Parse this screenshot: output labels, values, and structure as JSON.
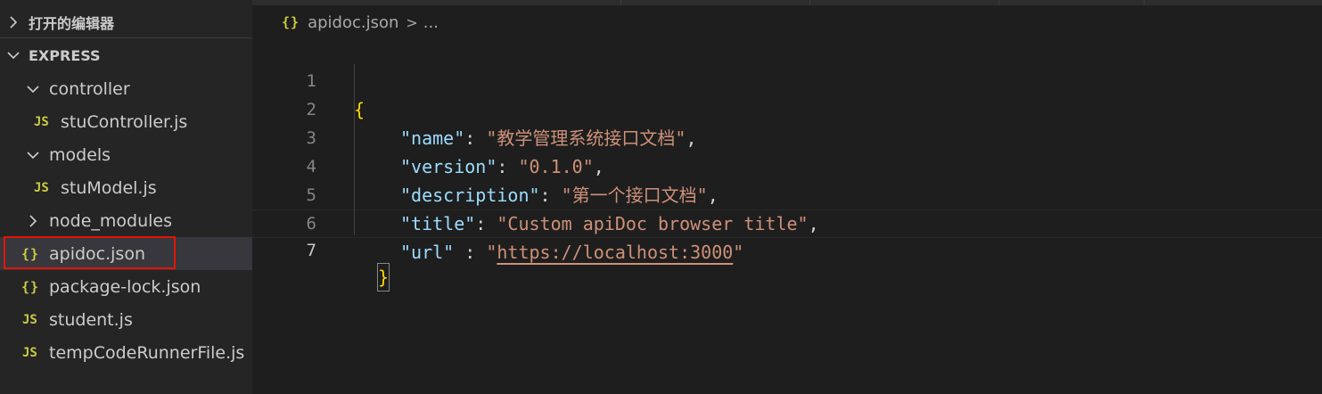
{
  "sidebar": {
    "open_editors_label": "打开的编辑器",
    "workspace_label": "EXPRESS",
    "tree": [
      {
        "label": "controller",
        "type": "folder",
        "expanded": true
      },
      {
        "label": "stuController.js",
        "type": "js",
        "icon_text": "JS"
      },
      {
        "label": "models",
        "type": "folder",
        "expanded": true
      },
      {
        "label": "stuModel.js",
        "type": "js",
        "icon_text": "JS"
      },
      {
        "label": "node_modules",
        "type": "folder",
        "expanded": false
      },
      {
        "label": "apidoc.json",
        "type": "json",
        "icon_text": "{}",
        "selected": true
      },
      {
        "label": "package-lock.json",
        "type": "json",
        "icon_text": "{}"
      },
      {
        "label": "student.js",
        "type": "js",
        "icon_text": "JS"
      },
      {
        "label": "tempCodeRunnerFile.js",
        "type": "js",
        "icon_text": "JS"
      }
    ]
  },
  "editor": {
    "breadcrumb": {
      "file_icon": "{}",
      "file": "apidoc.json",
      "separator": ">",
      "more": "..."
    },
    "lines": [
      {
        "num": "1",
        "text": "{"
      },
      {
        "num": "2",
        "key": "\"name\"",
        "sep": ": ",
        "value": "\"教学管理系统接口文档\"",
        "tail": ","
      },
      {
        "num": "3",
        "key": "\"version\"",
        "sep": ": ",
        "value": "\"0.1.0\"",
        "tail": ","
      },
      {
        "num": "4",
        "key": "\"description\"",
        "sep": ": ",
        "value": "\"第一个接口文档\"",
        "tail": ","
      },
      {
        "num": "5",
        "key": "\"title\"",
        "sep": ": ",
        "value": "\"Custom apiDoc browser title\"",
        "tail": ","
      },
      {
        "num": "6",
        "key": "\"url\"",
        "sep": " : ",
        "value_q1": "\"",
        "value_link": "https://localhost:3000",
        "value_q2": "\""
      },
      {
        "num": "7",
        "text": "}"
      }
    ]
  },
  "colors": {
    "sidebar_bg": "#252526",
    "editor_bg": "#1e1e1e",
    "selection_outline": "#e51400",
    "json_key": "#9cdcfe",
    "json_string": "#ce9178",
    "bracket": "#ffd700",
    "file_icon": "#cbcb41"
  }
}
